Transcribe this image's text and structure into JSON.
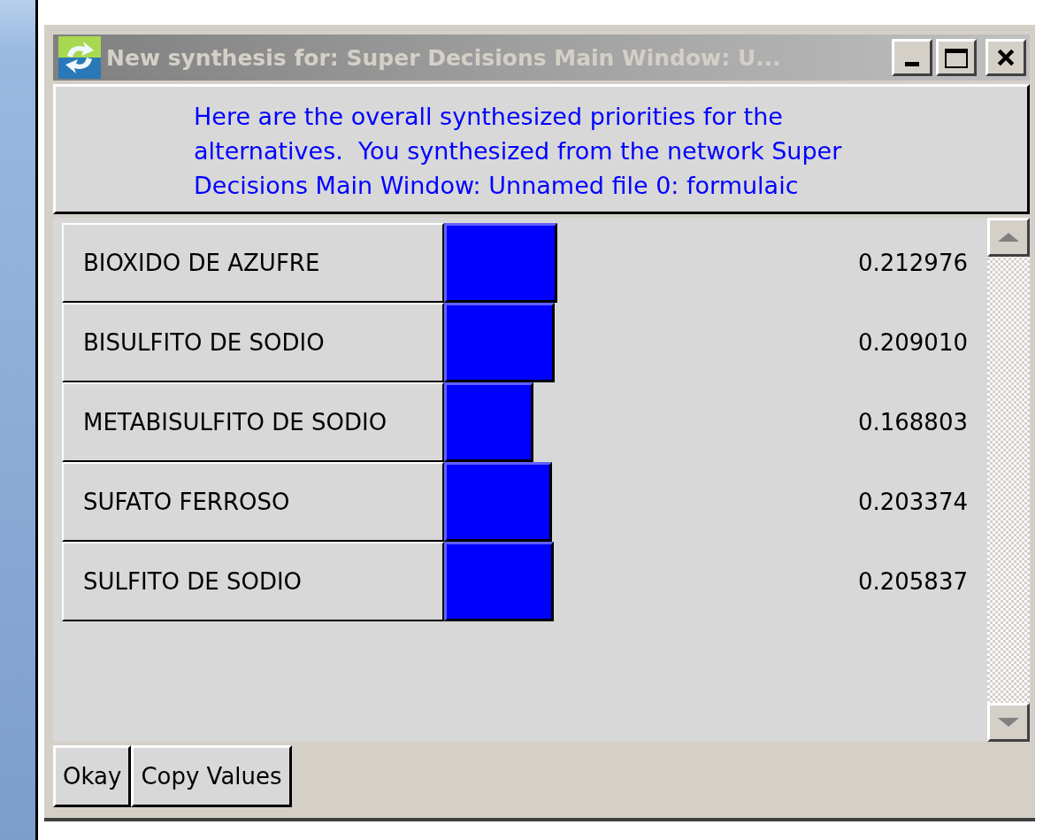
{
  "window": {
    "title": "New synthesis for: Super Decisions Main Window: U..."
  },
  "message": "Here are the overall synthesized priorities for the alternatives.  You synthesized from the network Super Decisions Main Window: Unnamed file 0: formulaic",
  "alternatives": [
    {
      "name": "BIOXIDO DE AZUFRE",
      "level": 0.212976,
      "value": "0.212976"
    },
    {
      "name": "BISULFITO DE SODIO",
      "level": 0.20901,
      "value": "0.209010"
    },
    {
      "name": "METABISULFITO DE SODIO",
      "level": 0.168803,
      "value": "0.168803"
    },
    {
      "name": "SUFATO FERROSO",
      "level": 0.203374,
      "value": "0.203374"
    },
    {
      "name": "SULFITO DE SODIO",
      "level": 0.205837,
      "value": "0.205837"
    }
  ],
  "buttons": [
    "Okay",
    "Copy Values"
  ]
}
